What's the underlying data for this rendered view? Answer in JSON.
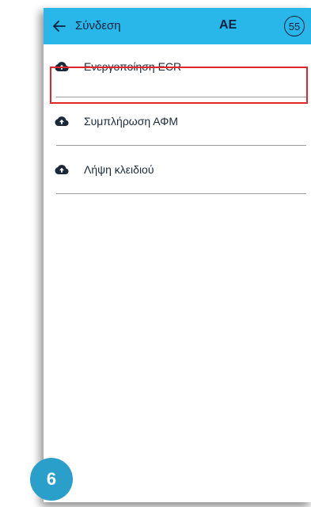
{
  "colors": {
    "header_bg": "#29b6e8",
    "highlight": "#e0262d",
    "step_bg": "#2a9fc9",
    "text_dark": "#0e2240"
  },
  "header": {
    "back_icon": "arrow-left-icon",
    "title": "Σύνδεση",
    "center_label": "AE",
    "badge": "55"
  },
  "menu": {
    "items": [
      {
        "label": "Ενεργοποίηση ECR",
        "icon": "cloud-upload-icon"
      },
      {
        "label": "Συμπλήρωση ΑΦΜ",
        "icon": "cloud-upload-icon",
        "highlighted": true
      },
      {
        "label": "Λήψη κλειδιού",
        "icon": "cloud-upload-icon"
      }
    ]
  },
  "step_marker": {
    "number": "6"
  }
}
